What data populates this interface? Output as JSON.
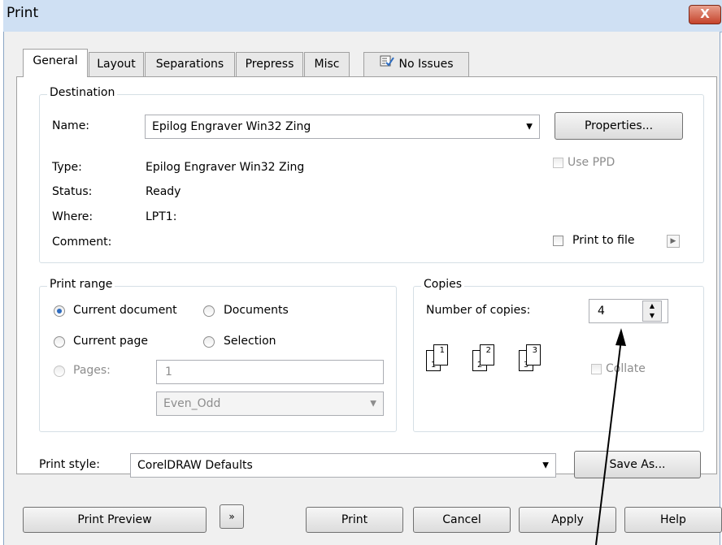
{
  "window": {
    "title": "Print",
    "close_glyph": "X"
  },
  "tabs": [
    {
      "label": "General",
      "active": true
    },
    {
      "label": "Layout"
    },
    {
      "label": "Separations"
    },
    {
      "label": "Prepress"
    },
    {
      "label": "Misc"
    },
    {
      "label": "No Issues"
    }
  ],
  "destination": {
    "legend": "Destination",
    "name_label": "Name:",
    "name_value": "Epilog Engraver Win32 Zing",
    "properties_button": "Properties...",
    "type_label": "Type:",
    "type_value": "Epilog Engraver Win32 Zing",
    "status_label": "Status:",
    "status_value": "Ready",
    "where_label": "Where:",
    "where_value": "LPT1:",
    "comment_label": "Comment:",
    "use_ppd_label": "Use PPD",
    "print_to_file_label": "Print to file"
  },
  "print_range": {
    "legend": "Print range",
    "current_document": "Current document",
    "documents": "Documents",
    "current_page": "Current page",
    "selection": "Selection",
    "pages_label": "Pages:",
    "pages_value": "1",
    "even_odd_value": "Even_Odd",
    "selected": "Current document"
  },
  "copies": {
    "legend": "Copies",
    "number_label": "Number of copies:",
    "number_value": "4",
    "collate_label": "Collate",
    "page_numbers": [
      "1",
      "1",
      "2",
      "2",
      "3",
      "3"
    ]
  },
  "print_style": {
    "label": "Print style:",
    "value": "CorelDRAW Defaults",
    "save_as_button": "Save As..."
  },
  "footer": {
    "print_preview": "Print Preview",
    "print": "Print",
    "cancel": "Cancel",
    "apply": "Apply",
    "help": "Help"
  },
  "colors": {
    "accent": "#2e6cc0",
    "titlebar": "#cfe0f3",
    "close": "#c5432b"
  }
}
